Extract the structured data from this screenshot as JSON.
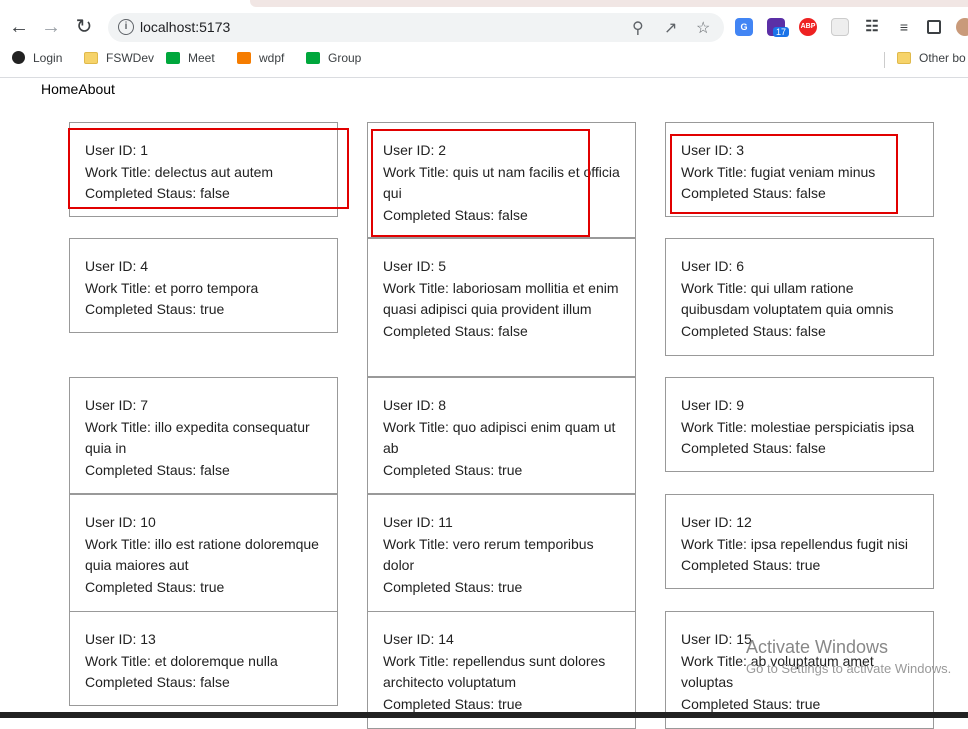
{
  "browser": {
    "url": "localhost:5173",
    "bookmarks": [
      "Login",
      "FSWDev",
      "Meet",
      "wdpf",
      "Group",
      "Other bo"
    ],
    "ext_badge": "17",
    "ext_abp": "ABP"
  },
  "app_nav": {
    "home": "Home",
    "about": "About"
  },
  "labels": {
    "user_id": "User ID: ",
    "work_title": "Work Title: ",
    "completed": "Completed Staus: "
  },
  "cards": [
    {
      "id": "1",
      "title": "delectus aut autem",
      "completed": "false"
    },
    {
      "id": "2",
      "title": "quis ut nam facilis et officia qui",
      "completed": "false"
    },
    {
      "id": "3",
      "title": "fugiat veniam minus",
      "completed": "false"
    },
    {
      "id": "4",
      "title": "et porro tempora",
      "completed": "true"
    },
    {
      "id": "5",
      "title": "laboriosam mollitia et enim quasi adipisci quia provident illum",
      "completed": "false"
    },
    {
      "id": "6",
      "title": "qui ullam ratione quibusdam voluptatem quia omnis",
      "completed": "false"
    },
    {
      "id": "7",
      "title": "illo expedita consequatur quia in",
      "completed": "false"
    },
    {
      "id": "8",
      "title": "quo adipisci enim quam ut ab",
      "completed": "true"
    },
    {
      "id": "9",
      "title": "molestiae perspiciatis ipsa",
      "completed": "false"
    },
    {
      "id": "10",
      "title": "illo est ratione doloremque quia maiores aut",
      "completed": "true"
    },
    {
      "id": "11",
      "title": "vero rerum temporibus dolor",
      "completed": "true"
    },
    {
      "id": "12",
      "title": "ipsa repellendus fugit nisi",
      "completed": "true"
    },
    {
      "id": "13",
      "title": "et doloremque nulla",
      "completed": "false"
    },
    {
      "id": "14",
      "title": "repellendus sunt dolores architecto voluptatum",
      "completed": "true"
    },
    {
      "id": "15",
      "title": "ab voluptatum amet voluptas",
      "completed": "true"
    }
  ],
  "watermark": {
    "title": "Activate Windows",
    "subtitle": "Go to Settings to activate Windows."
  }
}
